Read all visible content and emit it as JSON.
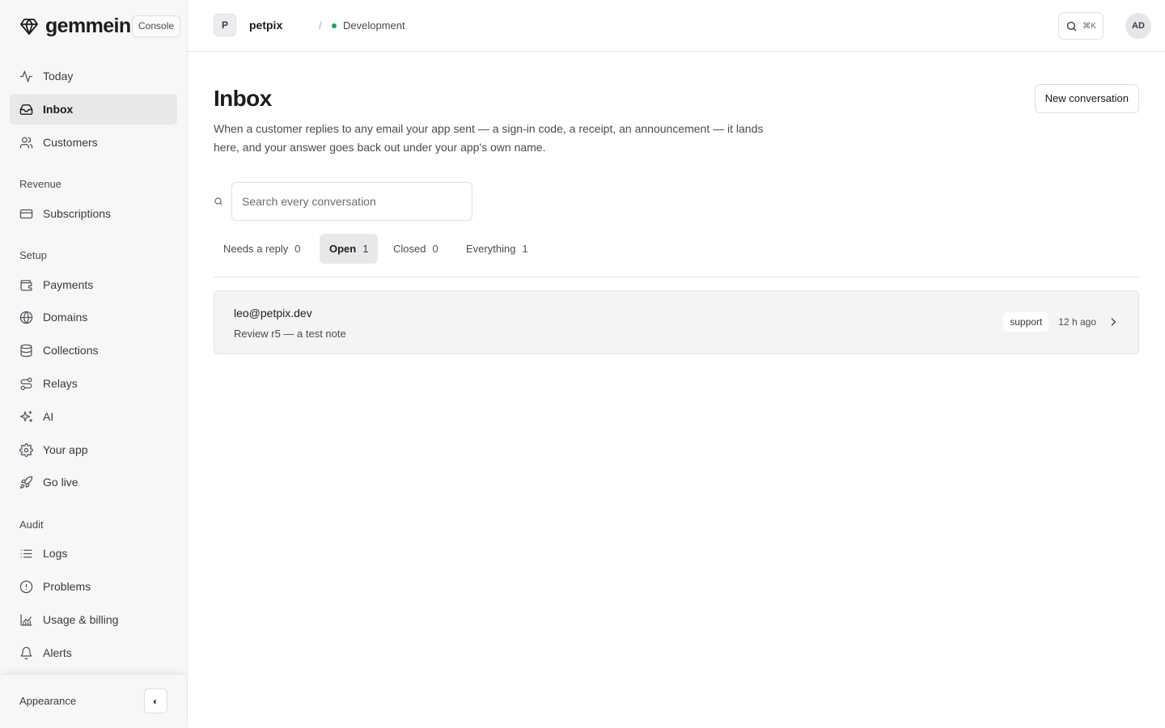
{
  "brand": {
    "name": "gemmein",
    "badge": "Console"
  },
  "sidebar": {
    "primary": [
      {
        "label": "Today",
        "icon": "activity-icon"
      },
      {
        "label": "Inbox",
        "icon": "inbox-icon",
        "active": true
      },
      {
        "label": "Customers",
        "icon": "users-icon"
      }
    ],
    "sections": [
      {
        "label": "Revenue",
        "items": [
          {
            "label": "Subscriptions",
            "icon": "credit-card-icon"
          }
        ]
      },
      {
        "label": "Setup",
        "items": [
          {
            "label": "Payments",
            "icon": "wallet-icon"
          },
          {
            "label": "Domains",
            "icon": "globe-icon"
          },
          {
            "label": "Collections",
            "icon": "database-icon"
          },
          {
            "label": "Relays",
            "icon": "route-icon"
          },
          {
            "label": "AI",
            "icon": "sparkles-icon"
          },
          {
            "label": "Your app",
            "icon": "gear-icon"
          },
          {
            "label": "Go live",
            "icon": "rocket-icon"
          }
        ]
      },
      {
        "label": "Audit",
        "items": [
          {
            "label": "Logs",
            "icon": "list-icon"
          },
          {
            "label": "Problems",
            "icon": "alert-circle-icon"
          },
          {
            "label": "Usage & billing",
            "icon": "chart-icon"
          },
          {
            "label": "Alerts",
            "icon": "bell-icon"
          }
        ]
      }
    ],
    "footer": {
      "appearance_label": "Appearance",
      "toggle_glyph": "◐"
    }
  },
  "topbar": {
    "project_initial": "P",
    "project_name": "petpix",
    "separator": "/",
    "environment": "Development",
    "environment_color": "#1f9d61",
    "search_shortcut": "⌘K",
    "user_initials": "AD"
  },
  "main": {
    "title": "Inbox",
    "new_button": "New conversation",
    "description": "When a customer replies to any email your app sent — a sign-in code, a receipt, an announcement — it lands here, and your answer goes back out under your app's own name.",
    "search_placeholder": "Search every conversation",
    "tabs": [
      {
        "label": "Needs a reply",
        "count": "0"
      },
      {
        "label": "Open",
        "count": "1",
        "active": true
      },
      {
        "label": "Closed",
        "count": "0"
      },
      {
        "label": "Everything",
        "count": "1"
      }
    ],
    "conversations": [
      {
        "from": "leo@petpix.dev",
        "subject": "Review r5 — a test note",
        "tag": "support",
        "time": "12 h ago"
      }
    ]
  }
}
